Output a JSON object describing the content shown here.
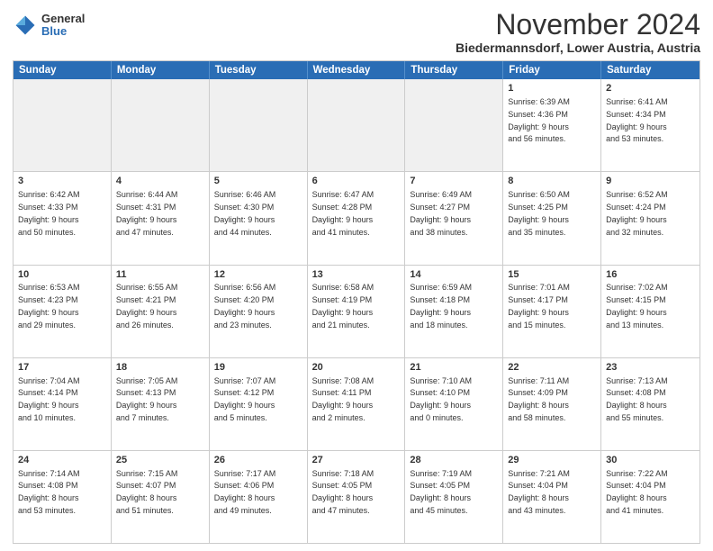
{
  "logo": {
    "general": "General",
    "blue": "Blue"
  },
  "header": {
    "month": "November 2024",
    "location": "Biedermannsdorf, Lower Austria, Austria"
  },
  "days": [
    "Sunday",
    "Monday",
    "Tuesday",
    "Wednesday",
    "Thursday",
    "Friday",
    "Saturday"
  ],
  "weeks": [
    [
      {
        "day": "",
        "content": ""
      },
      {
        "day": "",
        "content": ""
      },
      {
        "day": "",
        "content": ""
      },
      {
        "day": "",
        "content": ""
      },
      {
        "day": "",
        "content": ""
      },
      {
        "day": "1",
        "content": "Sunrise: 6:39 AM\nSunset: 4:36 PM\nDaylight: 9 hours\nand 56 minutes."
      },
      {
        "day": "2",
        "content": "Sunrise: 6:41 AM\nSunset: 4:34 PM\nDaylight: 9 hours\nand 53 minutes."
      }
    ],
    [
      {
        "day": "3",
        "content": "Sunrise: 6:42 AM\nSunset: 4:33 PM\nDaylight: 9 hours\nand 50 minutes."
      },
      {
        "day": "4",
        "content": "Sunrise: 6:44 AM\nSunset: 4:31 PM\nDaylight: 9 hours\nand 47 minutes."
      },
      {
        "day": "5",
        "content": "Sunrise: 6:46 AM\nSunset: 4:30 PM\nDaylight: 9 hours\nand 44 minutes."
      },
      {
        "day": "6",
        "content": "Sunrise: 6:47 AM\nSunset: 4:28 PM\nDaylight: 9 hours\nand 41 minutes."
      },
      {
        "day": "7",
        "content": "Sunrise: 6:49 AM\nSunset: 4:27 PM\nDaylight: 9 hours\nand 38 minutes."
      },
      {
        "day": "8",
        "content": "Sunrise: 6:50 AM\nSunset: 4:25 PM\nDaylight: 9 hours\nand 35 minutes."
      },
      {
        "day": "9",
        "content": "Sunrise: 6:52 AM\nSunset: 4:24 PM\nDaylight: 9 hours\nand 32 minutes."
      }
    ],
    [
      {
        "day": "10",
        "content": "Sunrise: 6:53 AM\nSunset: 4:23 PM\nDaylight: 9 hours\nand 29 minutes."
      },
      {
        "day": "11",
        "content": "Sunrise: 6:55 AM\nSunset: 4:21 PM\nDaylight: 9 hours\nand 26 minutes."
      },
      {
        "day": "12",
        "content": "Sunrise: 6:56 AM\nSunset: 4:20 PM\nDaylight: 9 hours\nand 23 minutes."
      },
      {
        "day": "13",
        "content": "Sunrise: 6:58 AM\nSunset: 4:19 PM\nDaylight: 9 hours\nand 21 minutes."
      },
      {
        "day": "14",
        "content": "Sunrise: 6:59 AM\nSunset: 4:18 PM\nDaylight: 9 hours\nand 18 minutes."
      },
      {
        "day": "15",
        "content": "Sunrise: 7:01 AM\nSunset: 4:17 PM\nDaylight: 9 hours\nand 15 minutes."
      },
      {
        "day": "16",
        "content": "Sunrise: 7:02 AM\nSunset: 4:15 PM\nDaylight: 9 hours\nand 13 minutes."
      }
    ],
    [
      {
        "day": "17",
        "content": "Sunrise: 7:04 AM\nSunset: 4:14 PM\nDaylight: 9 hours\nand 10 minutes."
      },
      {
        "day": "18",
        "content": "Sunrise: 7:05 AM\nSunset: 4:13 PM\nDaylight: 9 hours\nand 7 minutes."
      },
      {
        "day": "19",
        "content": "Sunrise: 7:07 AM\nSunset: 4:12 PM\nDaylight: 9 hours\nand 5 minutes."
      },
      {
        "day": "20",
        "content": "Sunrise: 7:08 AM\nSunset: 4:11 PM\nDaylight: 9 hours\nand 2 minutes."
      },
      {
        "day": "21",
        "content": "Sunrise: 7:10 AM\nSunset: 4:10 PM\nDaylight: 9 hours\nand 0 minutes."
      },
      {
        "day": "22",
        "content": "Sunrise: 7:11 AM\nSunset: 4:09 PM\nDaylight: 8 hours\nand 58 minutes."
      },
      {
        "day": "23",
        "content": "Sunrise: 7:13 AM\nSunset: 4:08 PM\nDaylight: 8 hours\nand 55 minutes."
      }
    ],
    [
      {
        "day": "24",
        "content": "Sunrise: 7:14 AM\nSunset: 4:08 PM\nDaylight: 8 hours\nand 53 minutes."
      },
      {
        "day": "25",
        "content": "Sunrise: 7:15 AM\nSunset: 4:07 PM\nDaylight: 8 hours\nand 51 minutes."
      },
      {
        "day": "26",
        "content": "Sunrise: 7:17 AM\nSunset: 4:06 PM\nDaylight: 8 hours\nand 49 minutes."
      },
      {
        "day": "27",
        "content": "Sunrise: 7:18 AM\nSunset: 4:05 PM\nDaylight: 8 hours\nand 47 minutes."
      },
      {
        "day": "28",
        "content": "Sunrise: 7:19 AM\nSunset: 4:05 PM\nDaylight: 8 hours\nand 45 minutes."
      },
      {
        "day": "29",
        "content": "Sunrise: 7:21 AM\nSunset: 4:04 PM\nDaylight: 8 hours\nand 43 minutes."
      },
      {
        "day": "30",
        "content": "Sunrise: 7:22 AM\nSunset: 4:04 PM\nDaylight: 8 hours\nand 41 minutes."
      }
    ]
  ]
}
